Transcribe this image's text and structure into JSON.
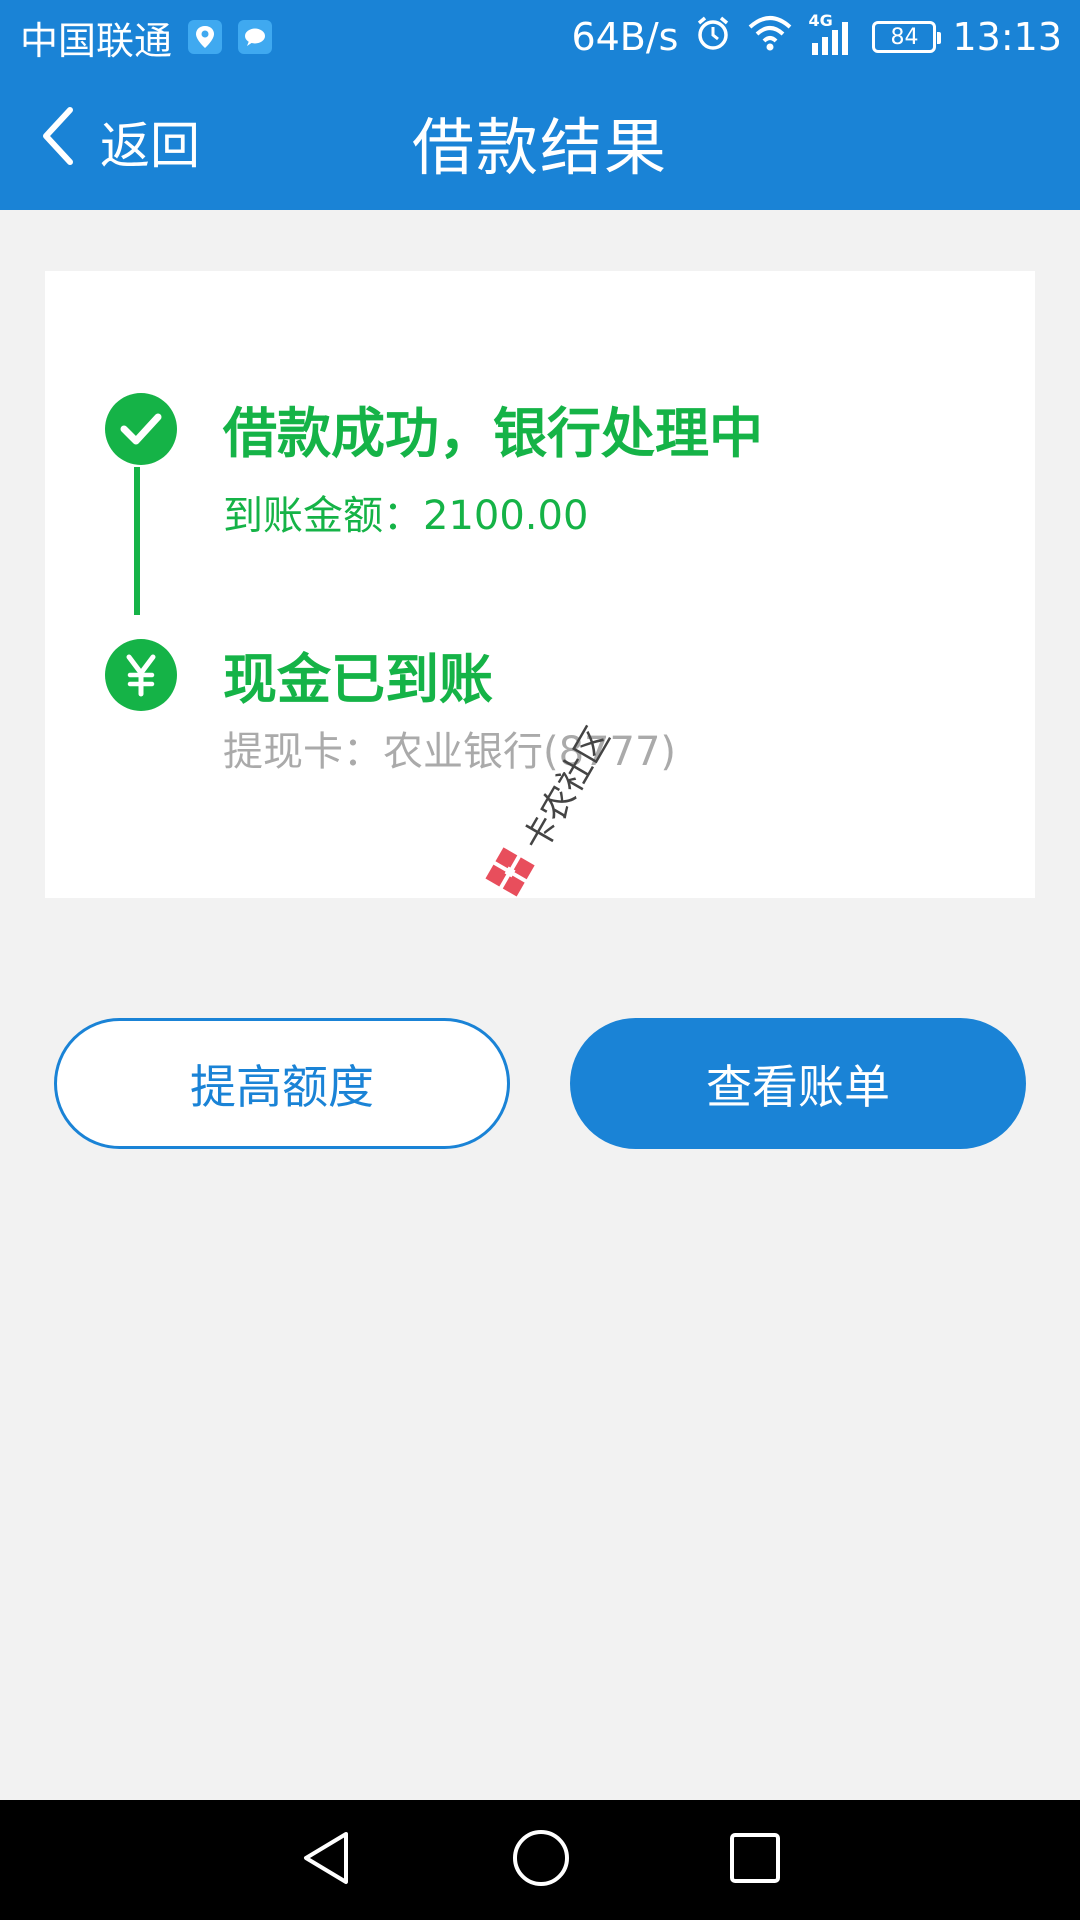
{
  "status_bar": {
    "carrier": "中国联通",
    "speed": "64B/s",
    "network": "4G",
    "battery": "84",
    "time": "13:13"
  },
  "header": {
    "back_label": "返回",
    "title": "借款结果"
  },
  "steps": [
    {
      "title": "借款成功，银行处理中",
      "subtitle": "到账金额：2100.00",
      "icon": "check-icon"
    },
    {
      "title": "现金已到账",
      "subtitle": "提现卡：农业银行(8777)",
      "icon": "yuan-icon"
    }
  ],
  "buttons": {
    "raise_limit": "提高额度",
    "view_bill": "查看账单"
  },
  "watermark": "卡农社区",
  "colors": {
    "primary": "#1a83d6",
    "success": "#15b347",
    "muted": "#aaaaaa",
    "background": "#f2f2f2"
  }
}
